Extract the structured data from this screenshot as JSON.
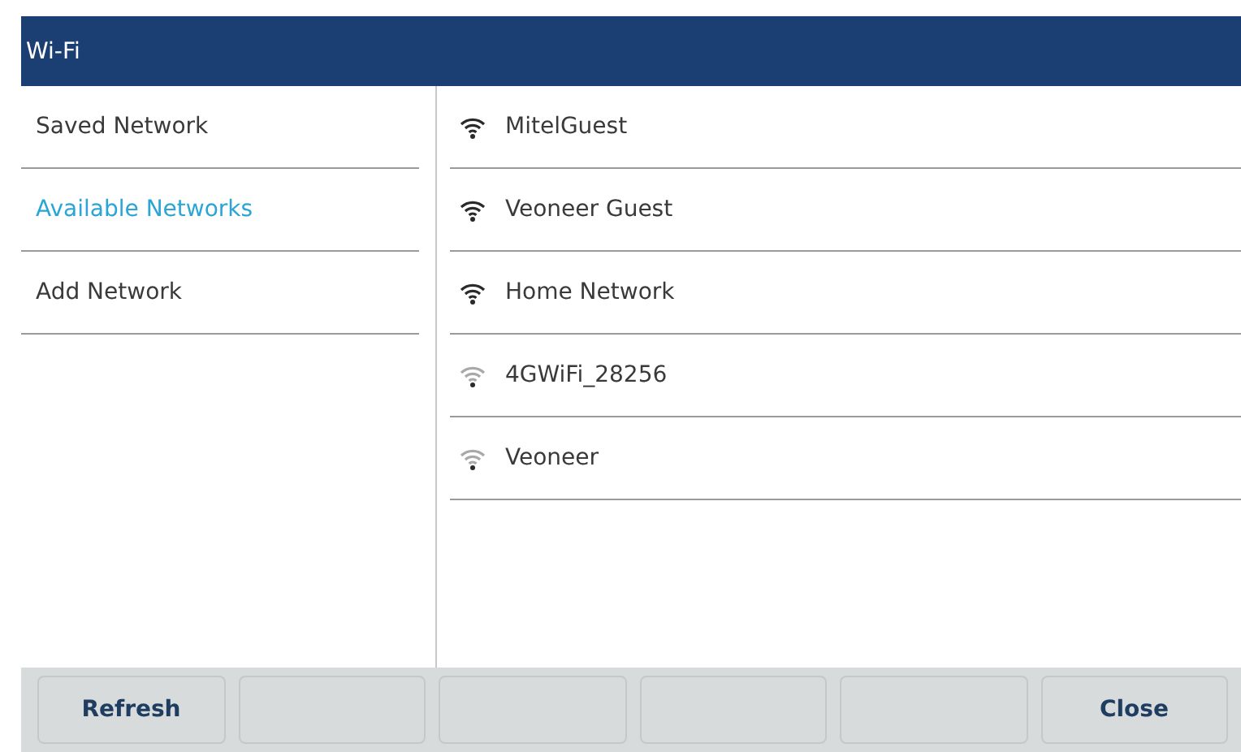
{
  "window": {
    "title": "Wi-Fi"
  },
  "sidebar": {
    "items": [
      {
        "label": "Saved Network",
        "selected": false
      },
      {
        "label": "Available Networks",
        "selected": true
      },
      {
        "label": "Add Network",
        "selected": false
      }
    ]
  },
  "networks": [
    {
      "name": "MitelGuest",
      "strong_signal": true
    },
    {
      "name": "Veoneer Guest",
      "strong_signal": true
    },
    {
      "name": "Home Network",
      "strong_signal": true
    },
    {
      "name": "4GWiFi_28256",
      "strong_signal": false
    },
    {
      "name": "Veoneer",
      "strong_signal": false
    }
  ],
  "softkeys": [
    {
      "kind": "labeled",
      "label": "Refresh"
    },
    {
      "kind": "blank"
    },
    {
      "kind": "blank"
    },
    {
      "kind": "blank"
    },
    {
      "kind": "blank"
    },
    {
      "kind": "labeled",
      "label": "Close"
    }
  ]
}
